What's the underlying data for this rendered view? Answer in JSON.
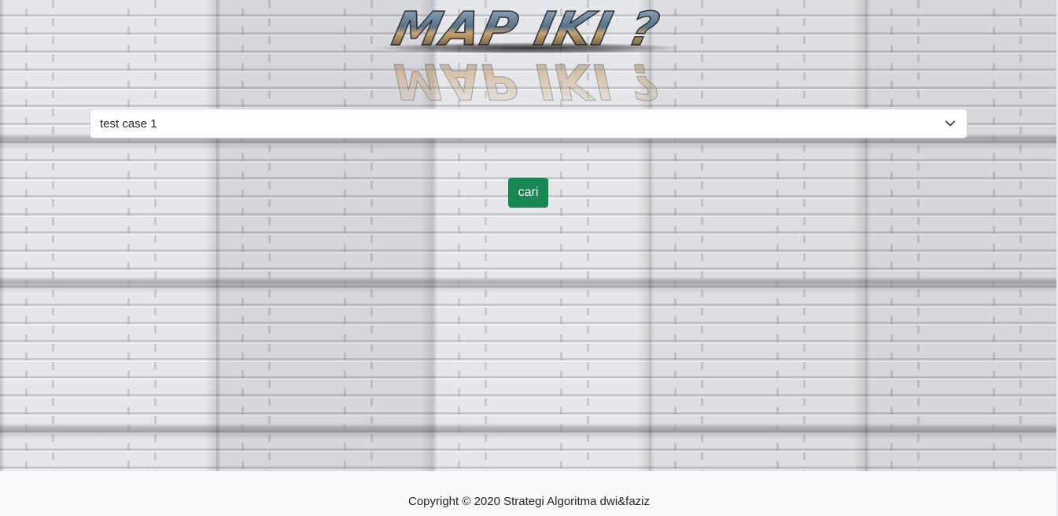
{
  "header": {
    "logo_text": "MAP IKI ?"
  },
  "form": {
    "select": {
      "selected": "test case 1"
    },
    "submit_label": "cari",
    "submit_color": "#198754"
  },
  "footer": {
    "copyright": "Copyright © 2020 Strategi Algoritma dwi&faziz"
  },
  "icons": {
    "select_chevron": "chevron-down-icon"
  }
}
